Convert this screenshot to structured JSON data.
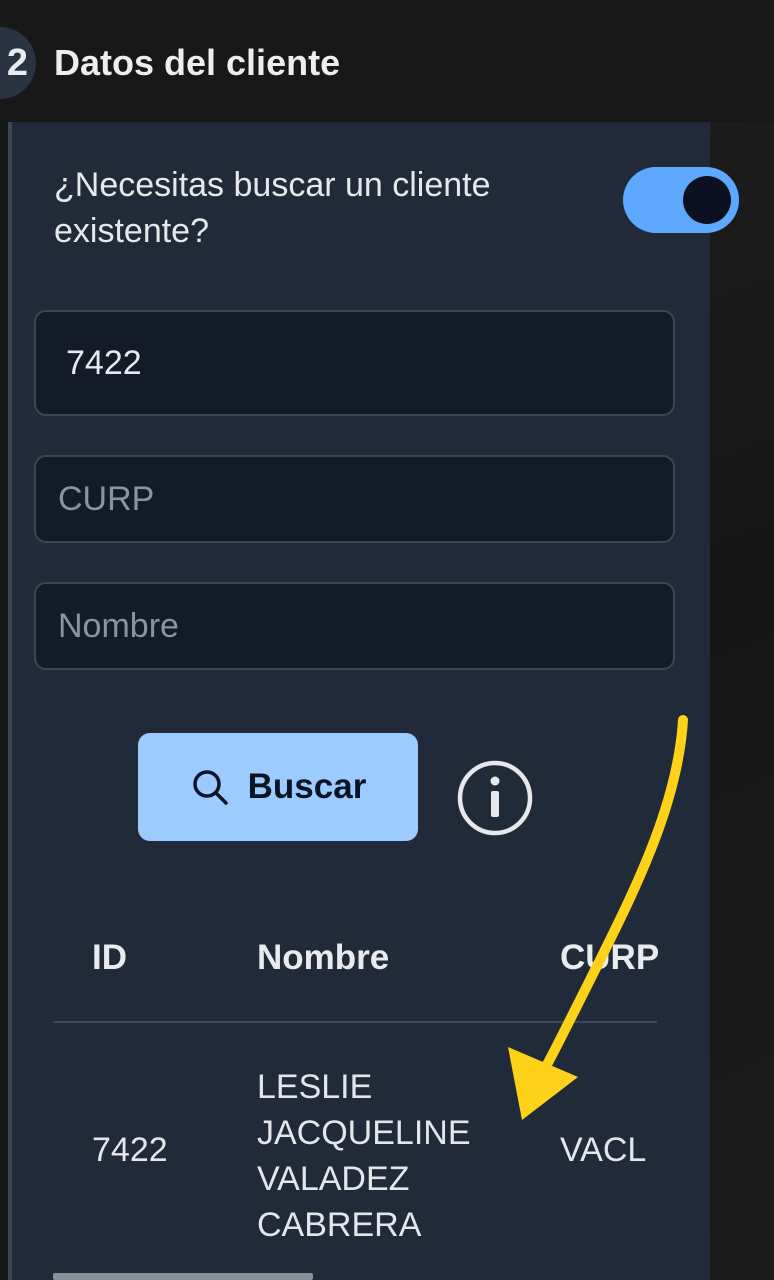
{
  "header": {
    "step_number": "2",
    "title": "Datos del cliente"
  },
  "search_toggle": {
    "label": "¿Necesitas buscar un cliente existente?",
    "enabled": true
  },
  "fields": {
    "id_value": "7422",
    "curp_placeholder": "CURP",
    "nombre_placeholder": "Nombre"
  },
  "search_button": {
    "label": "Buscar"
  },
  "results_table": {
    "columns": [
      "ID",
      "Nombre",
      "CURP"
    ],
    "rows": [
      {
        "id": "7422",
        "nombre_lines": [
          "LESLIE",
          "JACQUELINE",
          "VALADEZ",
          "CABRERA"
        ],
        "curp": "VACL"
      }
    ]
  },
  "colors": {
    "accent": "#5ea8ff",
    "button": "#9ccbff",
    "annotation_arrow": "#ffd21a",
    "panel": "#212a38"
  },
  "icons": [
    "search-icon",
    "info-icon",
    "annotation-arrow"
  ]
}
